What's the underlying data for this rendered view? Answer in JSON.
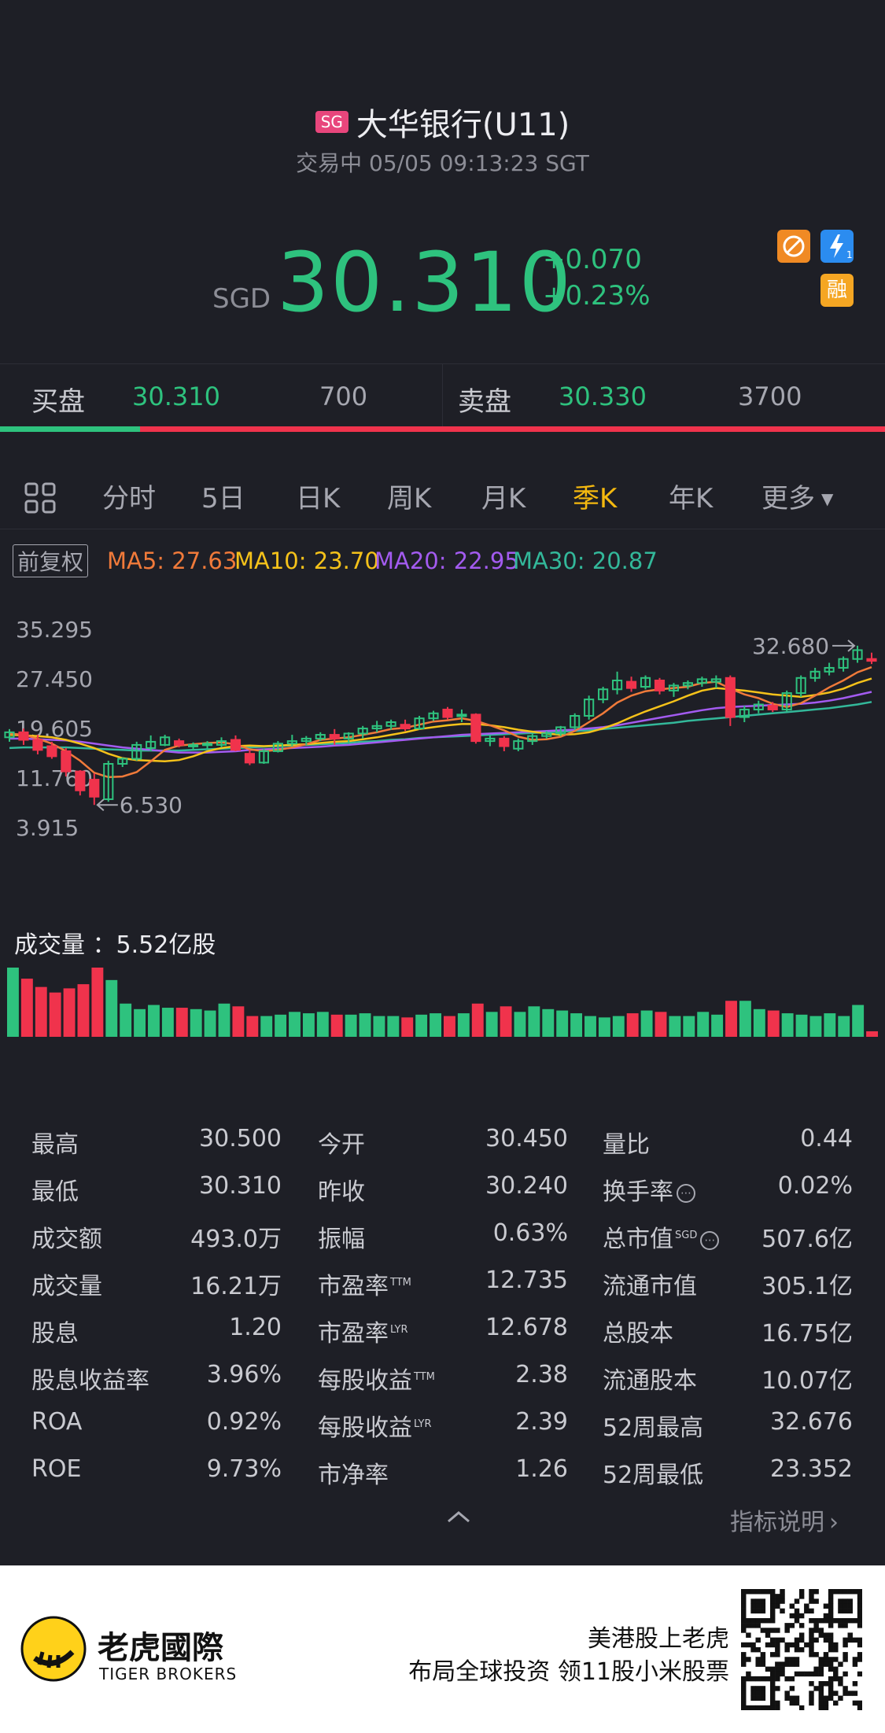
{
  "header": {
    "market_badge": "SG",
    "title": "大华银行(U11)",
    "status": "交易中 05/05 09:13:23 SGT"
  },
  "quote": {
    "currency": "SGD",
    "price": "30.310",
    "change": "+0.070",
    "change_pct": "+0.23%",
    "badges": [
      {
        "icon": "no-sign-icon",
        "color": "#f08a24"
      },
      {
        "icon": "lightning-icon",
        "color": "#2b8cf0",
        "text": "1"
      },
      {
        "icon": "margin-icon",
        "color": "#f5a623",
        "text": "融"
      }
    ]
  },
  "order_book": {
    "bid_label": "买盘",
    "bid_price": "30.310",
    "bid_size": "700",
    "ask_label": "卖盘",
    "ask_price": "30.330",
    "ask_size": "3700",
    "bid_ratio": 0.158
  },
  "tabs": [
    {
      "label": "分时"
    },
    {
      "label": "5日"
    },
    {
      "label": "日K"
    },
    {
      "label": "周K"
    },
    {
      "label": "月K"
    },
    {
      "label": "季K",
      "active": true
    },
    {
      "label": "年K"
    },
    {
      "label": "更多"
    }
  ],
  "ma": {
    "adjust_label": "前复权",
    "ma5": "MA5: 27.63",
    "ma10": "MA10: 23.70",
    "ma20": "MA20: 22.95",
    "ma30": "MA30: 20.87",
    "colors": {
      "ma5": "#f07a3a",
      "ma10": "#f5c21a",
      "ma20": "#a35bf0",
      "ma30": "#33b89a"
    }
  },
  "chart_data": {
    "type": "candlestick",
    "y_ticks": [
      "35.295",
      "27.450",
      "19.605",
      "11.760",
      "3.915"
    ],
    "ylim": [
      3.915,
      35.295
    ],
    "max_annotation": "32.680",
    "min_annotation": "6.530",
    "volume_label": "成交量 ：5.52亿股",
    "colors": {
      "up": "#2ec27e",
      "down": "#f0334c"
    },
    "candles": [
      [
        18.2,
        19.5,
        17.5,
        19.0
      ],
      [
        19.0,
        19.6,
        17.0,
        17.8
      ],
      [
        17.8,
        18.6,
        15.5,
        16.2
      ],
      [
        16.8,
        17.5,
        14.8,
        15.2
      ],
      [
        16.0,
        16.5,
        12.0,
        12.8
      ],
      [
        12.8,
        13.0,
        9.0,
        9.8
      ],
      [
        11.5,
        12.5,
        7.5,
        8.8
      ],
      [
        8.4,
        14.5,
        8.0,
        14.0
      ],
      [
        14.0,
        15.0,
        13.5,
        14.8
      ],
      [
        14.8,
        17.5,
        14.5,
        17.0
      ],
      [
        16.5,
        18.5,
        16.0,
        17.5
      ],
      [
        17.0,
        18.6,
        16.8,
        18.2
      ],
      [
        17.6,
        18.0,
        16.6,
        17.0
      ],
      [
        16.8,
        17.4,
        16.2,
        17.0
      ],
      [
        17.0,
        17.6,
        16.2,
        17.2
      ],
      [
        17.0,
        18.2,
        16.6,
        17.6
      ],
      [
        17.8,
        18.5,
        16.0,
        16.2
      ],
      [
        15.6,
        16.2,
        13.8,
        14.2
      ],
      [
        14.2,
        16.4,
        14.0,
        16.0
      ],
      [
        16.0,
        17.6,
        15.8,
        17.2
      ],
      [
        17.2,
        18.6,
        16.8,
        17.6
      ],
      [
        17.6,
        18.4,
        17.0,
        18.0
      ],
      [
        18.0,
        19.0,
        17.6,
        18.6
      ],
      [
        18.6,
        19.5,
        17.0,
        18.0
      ],
      [
        18.0,
        19.0,
        17.2,
        18.8
      ],
      [
        18.8,
        20.0,
        18.0,
        19.6
      ],
      [
        19.6,
        20.8,
        19.0,
        20.0
      ],
      [
        20.0,
        21.0,
        19.4,
        20.6
      ],
      [
        20.2,
        21.0,
        19.2,
        19.6
      ],
      [
        19.6,
        21.6,
        19.4,
        21.2
      ],
      [
        21.2,
        22.4,
        20.8,
        22.0
      ],
      [
        22.6,
        23.0,
        21.0,
        21.4
      ],
      [
        21.6,
        22.6,
        20.6,
        21.8
      ],
      [
        21.8,
        22.0,
        17.2,
        17.6
      ],
      [
        17.6,
        18.6,
        16.8,
        18.0
      ],
      [
        18.0,
        18.4,
        16.0,
        16.8
      ],
      [
        16.4,
        18.0,
        16.0,
        17.6
      ],
      [
        17.6,
        18.8,
        17.0,
        18.4
      ],
      [
        18.4,
        19.2,
        18.0,
        18.8
      ],
      [
        18.8,
        20.0,
        18.4,
        19.8
      ],
      [
        19.8,
        22.0,
        19.4,
        21.6
      ],
      [
        21.6,
        24.8,
        21.0,
        24.2
      ],
      [
        24.2,
        26.2,
        23.6,
        25.8
      ],
      [
        25.8,
        28.6,
        25.0,
        27.2
      ],
      [
        27.0,
        27.8,
        25.4,
        26.0
      ],
      [
        26.2,
        28.0,
        25.8,
        27.6
      ],
      [
        27.2,
        27.6,
        25.0,
        25.6
      ],
      [
        25.6,
        26.8,
        24.6,
        26.4
      ],
      [
        26.4,
        27.2,
        25.8,
        26.8
      ],
      [
        26.8,
        27.8,
        26.2,
        27.4
      ],
      [
        27.0,
        28.0,
        26.0,
        27.4
      ],
      [
        27.6,
        28.0,
        20.0,
        21.4
      ],
      [
        21.4,
        23.2,
        20.6,
        22.6
      ],
      [
        22.6,
        24.0,
        22.0,
        23.4
      ],
      [
        23.2,
        23.8,
        22.2,
        22.6
      ],
      [
        22.6,
        25.6,
        22.2,
        25.2
      ],
      [
        25.2,
        28.0,
        24.6,
        27.6
      ],
      [
        27.6,
        29.2,
        27.0,
        28.6
      ],
      [
        28.6,
        30.0,
        28.0,
        29.2
      ],
      [
        29.2,
        31.0,
        28.6,
        30.6
      ],
      [
        30.6,
        32.7,
        30.0,
        32.0
      ],
      [
        30.6,
        31.6,
        29.8,
        30.3
      ]
    ],
    "ma5": [
      18.8,
      18.6,
      18.0,
      17.2,
      16.0,
      14.5,
      12.6,
      11.9,
      12.0,
      12.7,
      14.4,
      16.2,
      16.9,
      17.1,
      17.3,
      17.4,
      17.1,
      16.3,
      16.0,
      16.2,
      16.6,
      17.1,
      17.8,
      18.0,
      18.2,
      18.6,
      19.0,
      19.5,
      19.7,
      20.2,
      20.7,
      20.9,
      21.2,
      20.8,
      20.1,
      19.3,
      18.3,
      17.8,
      17.9,
      18.3,
      19.2,
      20.6,
      22.0,
      23.7,
      24.8,
      25.5,
      25.8,
      26.0,
      26.2,
      26.8,
      27.0,
      25.9,
      25.0,
      24.4,
      23.5,
      23.0,
      23.6,
      24.8,
      26.1,
      27.2,
      28.5,
      29.3
    ],
    "ma10": [
      18.6,
      18.5,
      18.4,
      18.2,
      17.8,
      17.2,
      16.5,
      15.6,
      14.9,
      14.6,
      14.5,
      14.4,
      14.6,
      15.2,
      16.0,
      16.5,
      16.8,
      16.9,
      16.8,
      16.9,
      17.0,
      17.1,
      17.3,
      17.5,
      17.6,
      17.9,
      18.2,
      18.6,
      19.0,
      19.5,
      19.8,
      20.1,
      20.3,
      20.3,
      20.1,
      19.8,
      19.4,
      19.1,
      18.8,
      18.6,
      18.7,
      19.0,
      19.6,
      20.4,
      21.4,
      22.3,
      23.1,
      23.9,
      24.8,
      25.6,
      26.0,
      25.8,
      25.6,
      25.3,
      25.0,
      24.8,
      24.6,
      24.9,
      25.3,
      25.9,
      26.8,
      27.5
    ],
    "ma20": [
      18.0,
      18.0,
      17.9,
      17.8,
      17.7,
      17.5,
      17.2,
      16.9,
      16.6,
      16.4,
      16.2,
      16.0,
      15.8,
      15.8,
      15.8,
      15.9,
      16.0,
      16.2,
      16.3,
      16.4,
      16.5,
      16.6,
      16.7,
      16.9,
      17.0,
      17.2,
      17.4,
      17.6,
      17.8,
      18.0,
      18.2,
      18.4,
      18.6,
      18.7,
      18.8,
      18.9,
      19.0,
      19.1,
      19.2,
      19.3,
      19.4,
      19.6,
      19.8,
      20.1,
      20.5,
      20.9,
      21.3,
      21.7,
      22.1,
      22.5,
      22.8,
      23.0,
      23.1,
      23.2,
      23.3,
      23.4,
      23.5,
      23.7,
      24.0,
      24.4,
      24.9,
      25.4
    ],
    "ma30": [
      16.5,
      16.6,
      16.6,
      16.6,
      16.6,
      16.5,
      16.4,
      16.3,
      16.2,
      16.1,
      16.1,
      16.1,
      16.1,
      16.2,
      16.3,
      16.4,
      16.5,
      16.6,
      16.7,
      16.8,
      16.9,
      17.0,
      17.1,
      17.2,
      17.3,
      17.5,
      17.6,
      17.8,
      17.9,
      18.1,
      18.2,
      18.3,
      18.4,
      18.5,
      18.6,
      18.7,
      18.8,
      18.9,
      19.0,
      19.1,
      19.2,
      19.3,
      19.5,
      19.7,
      19.9,
      20.1,
      20.3,
      20.5,
      20.8,
      21.0,
      21.2,
      21.4,
      21.6,
      21.8,
      22.0,
      22.2,
      22.4,
      22.6,
      22.8,
      23.1,
      23.4,
      23.8
    ],
    "volume": [
      1.0,
      0.84,
      0.72,
      0.64,
      0.7,
      0.76,
      1.0,
      0.82,
      0.48,
      0.4,
      0.46,
      0.42,
      0.42,
      0.4,
      0.38,
      0.48,
      0.44,
      0.3,
      0.3,
      0.32,
      0.36,
      0.34,
      0.36,
      0.32,
      0.32,
      0.34,
      0.3,
      0.3,
      0.28,
      0.32,
      0.34,
      0.3,
      0.34,
      0.48,
      0.36,
      0.44,
      0.36,
      0.44,
      0.4,
      0.38,
      0.34,
      0.3,
      0.28,
      0.3,
      0.34,
      0.38,
      0.36,
      0.3,
      0.3,
      0.36,
      0.32,
      0.52,
      0.52,
      0.4,
      0.38,
      0.34,
      0.32,
      0.3,
      0.34,
      0.3,
      0.46,
      0.08
    ]
  },
  "stats": [
    [
      {
        "label": "最高",
        "value": "30.500"
      },
      {
        "label": "今开",
        "value": "30.450"
      },
      {
        "label": "量比",
        "value": "0.44"
      }
    ],
    [
      {
        "label": "最低",
        "value": "30.310"
      },
      {
        "label": "昨收",
        "value": "30.240"
      },
      {
        "label": "换手率",
        "value": "0.02%",
        "info": true
      }
    ],
    [
      {
        "label": "成交额",
        "value": "493.0万"
      },
      {
        "label": "振幅",
        "value": "0.63%"
      },
      {
        "label": "总市值",
        "sup": "SGD",
        "value": "507.6亿",
        "info": true
      }
    ],
    [
      {
        "label": "成交量",
        "value": "16.21万"
      },
      {
        "label": "市盈率",
        "sup": "TTM",
        "value": "12.735"
      },
      {
        "label": "流通市值",
        "value": "305.1亿"
      }
    ],
    [
      {
        "label": "股息",
        "value": "1.20"
      },
      {
        "label": "市盈率",
        "sup": "LYR",
        "value": "12.678"
      },
      {
        "label": "总股本",
        "value": "16.75亿"
      }
    ],
    [
      {
        "label": "股息收益率",
        "value": "3.96%"
      },
      {
        "label": "每股收益",
        "sup": "TTM",
        "value": "2.38"
      },
      {
        "label": "流通股本",
        "value": "10.07亿"
      }
    ],
    [
      {
        "label": "ROA",
        "value": "0.92%"
      },
      {
        "label": "每股收益",
        "sup": "LYR",
        "value": "2.39"
      },
      {
        "label": "52周最高",
        "value": "32.676"
      }
    ],
    [
      {
        "label": "ROE",
        "value": "9.73%"
      },
      {
        "label": "市净率",
        "value": "1.26"
      },
      {
        "label": "52周最低",
        "value": "23.352"
      }
    ]
  ],
  "indicator_link": "指标说明",
  "footer": {
    "brand_cn": "老虎國際",
    "brand_en": "TIGER BROKERS",
    "slogan1": "美港股上老虎",
    "slogan2": "布局全球投资 领11股小米股票"
  }
}
